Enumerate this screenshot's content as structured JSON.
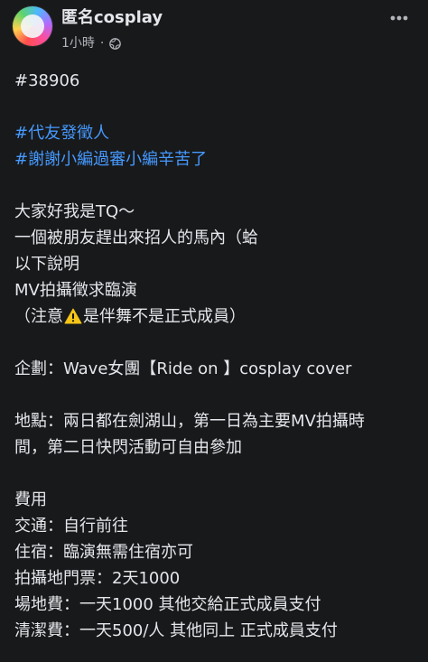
{
  "post": {
    "author": "匿名cosplay",
    "time": "1小時",
    "separator": "·",
    "privacy_icon": "globe-icon",
    "more_icon": "more-options-icon"
  },
  "body": {
    "post_id": "#38906",
    "hashtag_1": "#代友發徵人",
    "hashtag_2": "#謝謝小編過審小編辛苦了",
    "intro_1": "大家好我是TQ～",
    "intro_2": "一個被朋友趕出來招人的馬內（蛤",
    "intro_3": "以下說明",
    "intro_4": "MV拍攝徵求臨演",
    "note_prefix": "（注意",
    "note_suffix": "是伴舞不是正式成員）",
    "plan": "企劃：Wave女團【Ride on 】cosplay cover",
    "location_1": "地點：兩日都在劍湖山，第一日為主要MV拍攝時",
    "location_2": "間，第二日快閃活動可自由參加",
    "fees_title": "費用",
    "fee_transport": "交通：自行前往",
    "fee_lodging": "住宿：臨演無需住宿亦可",
    "fee_ticket": "拍攝地門票：2天1000",
    "fee_venue": "場地費：一天1000 其他交給正式成員支付",
    "fee_cleaning": "清潔費：一天500/人 其他同上 正式成員支付"
  },
  "colors": {
    "background": "#18191a",
    "text": "#e4e6eb",
    "secondary_text": "#b0b3b8",
    "hashtag": "#4599ff",
    "warning": "#f5c518"
  }
}
